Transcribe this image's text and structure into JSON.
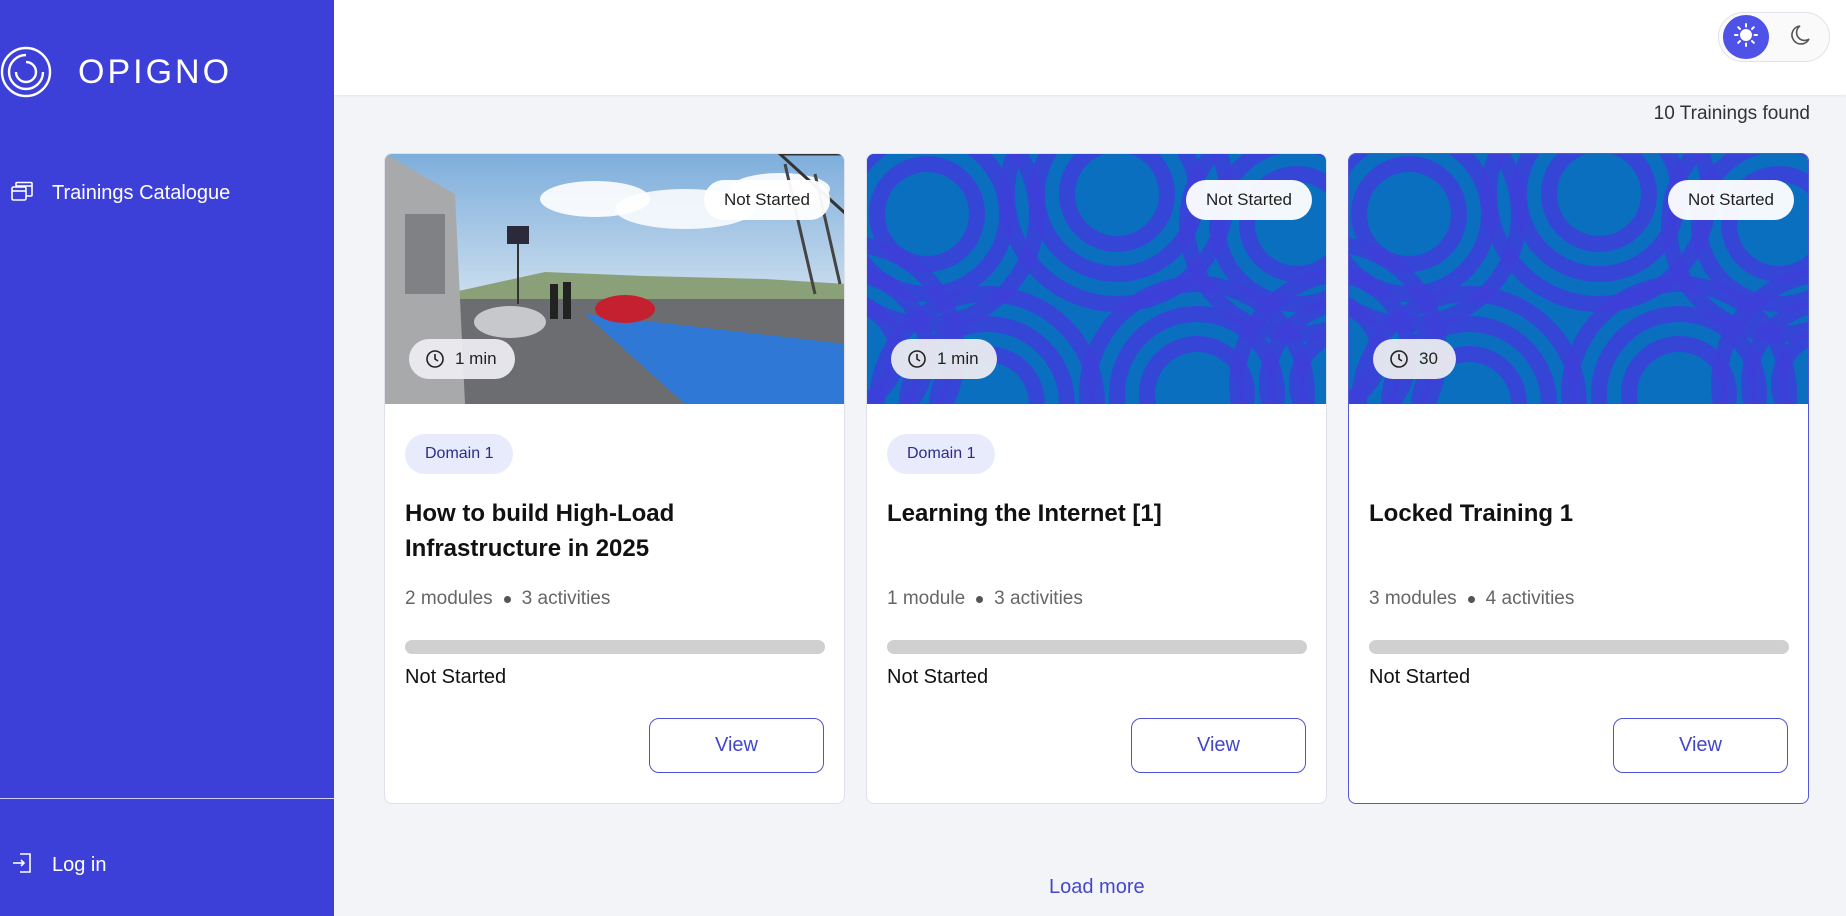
{
  "sidebar": {
    "logo_text": "OPIGNO",
    "nav_items": [
      {
        "label": "Trainings Catalogue",
        "icon": "catalogue-icon"
      }
    ],
    "login_label": "Log in"
  },
  "header": {
    "theme_toggle": {
      "active": "light",
      "options": [
        "sun-icon",
        "moon-icon"
      ]
    }
  },
  "main": {
    "results_count": "10 Trainings found",
    "load_more_label": "Load more",
    "cards": [
      {
        "status": "Not Started",
        "duration": "1 min",
        "domain": "Domain 1",
        "title": "How to build High-Load Infrastructure in 2025",
        "modules": "2 modules",
        "activities": "3 activities",
        "progress_fraction": 0,
        "progress_label": "Not Started",
        "button_label": "View",
        "image": "photo"
      },
      {
        "status": "Not Started",
        "duration": "1 min",
        "domain": "Domain 1",
        "title": "Learning the Internet [1]",
        "modules": "1 module",
        "activities": "3 activities",
        "progress_fraction": 0,
        "progress_label": "Not Started",
        "button_label": "View",
        "image": "pattern"
      },
      {
        "status": "Not Started",
        "duration": "30",
        "domain": "",
        "title": "Locked Training 1",
        "modules": "3 modules",
        "activities": "4 activities",
        "progress_fraction": 0,
        "progress_label": "Not Started",
        "button_label": "View",
        "image": "pattern"
      }
    ]
  },
  "colors": {
    "sidebar_bg": "#3d3fd9",
    "accent": "#4f52e6",
    "pattern_base": "#0a6fbf",
    "pattern_arc": "#3d3fd9"
  }
}
